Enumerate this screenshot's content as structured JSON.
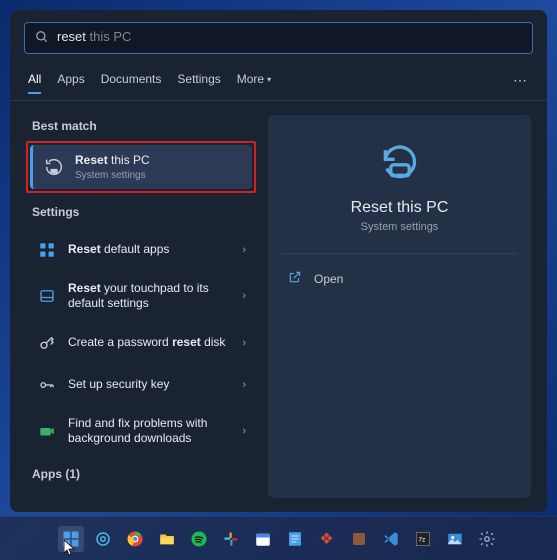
{
  "search": {
    "typed": "reset",
    "suggestion": " this PC"
  },
  "tabs": {
    "all": "All",
    "apps": "Apps",
    "documents": "Documents",
    "settings": "Settings",
    "more": "More"
  },
  "sections": {
    "best_match": "Best match",
    "settings": "Settings",
    "apps_count": "Apps (1)"
  },
  "best_match": {
    "title_prefix": "Reset",
    "title_suffix": " this PC",
    "subtitle": "System settings"
  },
  "settings_results": [
    {
      "title_b": "Reset",
      "title_rest": " default apps",
      "icon_color": "#4aa0e8"
    },
    {
      "title_b": "Reset",
      "title_rest": " your touchpad to its default settings",
      "icon_color": "#4aa0e8"
    },
    {
      "title_b": "",
      "title_rest": "Create a password ",
      "title_b2": "reset",
      "title_rest2": " disk",
      "icon_color": "#a8b4c8"
    },
    {
      "title_b": "",
      "title_rest": "Set up security key",
      "icon_color": "#a8b4c8"
    },
    {
      "title_b": "",
      "title_rest": "Find and fix problems with background downloads",
      "icon_color": "#36b368"
    }
  ],
  "preview": {
    "title": "Reset this PC",
    "subtitle": "System settings",
    "actions": {
      "open": "Open"
    }
  }
}
